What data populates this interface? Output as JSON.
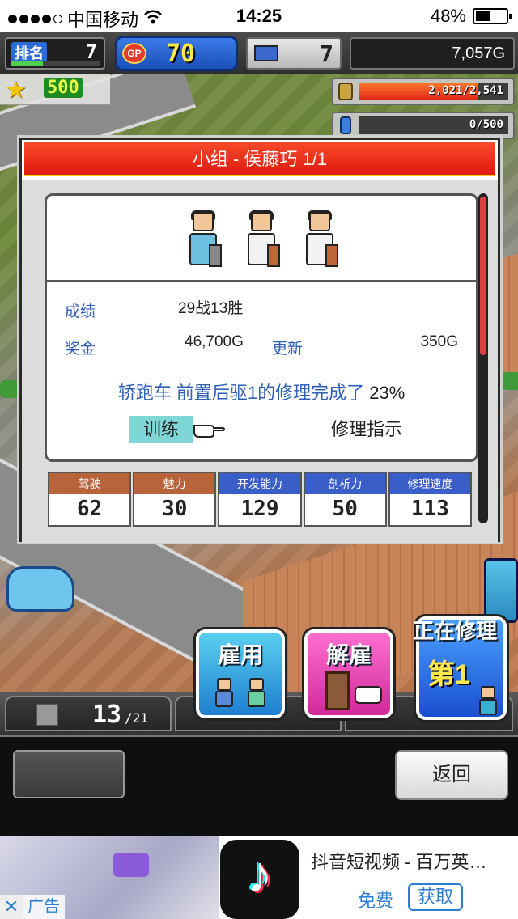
{
  "status_bar": {
    "carrier": "中国移动",
    "time": "14:25",
    "battery": "48%",
    "battery_level": 0.48,
    "signal_dots": 4
  },
  "hud": {
    "rank_label": "排名",
    "rank_value": "7",
    "gp_coin": "GP",
    "gp_value": "70",
    "computer_value": "7",
    "money": "7,057G",
    "star_value": "500",
    "research": "2,021/2,541",
    "research_fraction": 0.795,
    "fuel": "0/500",
    "fuel_fraction": 0.0
  },
  "dialog": {
    "title": "小组 - 侯藤巧 1/1",
    "record_label": "成绩",
    "record_value": "29战13胜",
    "prize_label": "奖金",
    "prize_value": "46,700G",
    "renew_label": "更新",
    "renew_value": "350G",
    "progress_msg": "轿跑车 前置后驱1的修理完成了",
    "progress_pct": "23%",
    "train_button": "训练",
    "repair_button": "修理指示",
    "stats": [
      {
        "label": "驾驶",
        "value": "62",
        "color": "brown"
      },
      {
        "label": "魅力",
        "value": "30",
        "color": "brown"
      },
      {
        "label": "开发能力",
        "value": "129",
        "color": "blue"
      },
      {
        "label": "剖析力",
        "value": "50",
        "color": "blue"
      },
      {
        "label": "修理速度",
        "value": "113",
        "color": "blue"
      }
    ]
  },
  "actions": {
    "hire": "雇用",
    "fire": "解雇",
    "repairing": "正在修理",
    "rank_badge": "第1"
  },
  "bottom": {
    "count": "13",
    "count_max": "/21",
    "back_button": "返回"
  },
  "ad": {
    "close": "✕",
    "tag": "广告",
    "title": "抖音短视频 - 百万英…",
    "free": "免费",
    "get_button": "获取"
  },
  "colors": {
    "title_red": "#e01a10",
    "label_blue": "#3060b8",
    "train_highlight": "#7fd6d6",
    "stat_brown": "#b8643a",
    "stat_blue": "#3a5ec8"
  }
}
